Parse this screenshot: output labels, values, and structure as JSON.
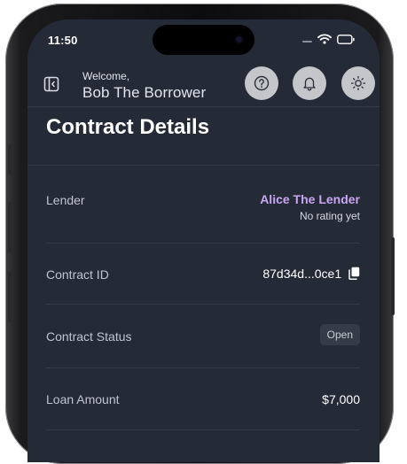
{
  "status_bar": {
    "time": "11:50"
  },
  "header": {
    "welcome": "Welcome,",
    "username": "Bob The Borrower",
    "icons": [
      "sidebar-toggle-icon",
      "help-icon",
      "bell-icon",
      "sun-icon"
    ]
  },
  "page": {
    "title": "Contract Details"
  },
  "details": {
    "lender": {
      "label": "Lender",
      "name": "Alice The Lender",
      "rating": "No rating yet"
    },
    "contract_id": {
      "label": "Contract ID",
      "value": "87d34d...0ce1"
    },
    "contract_status": {
      "label": "Contract Status",
      "value": "Open"
    },
    "loan_amount": {
      "label": "Loan Amount",
      "value": "$7,000"
    }
  },
  "colors": {
    "background": "#252a37",
    "lender_accent": "#c9a5f2",
    "header_button": "#c4c6ca",
    "badge_bg": "#353b47"
  }
}
